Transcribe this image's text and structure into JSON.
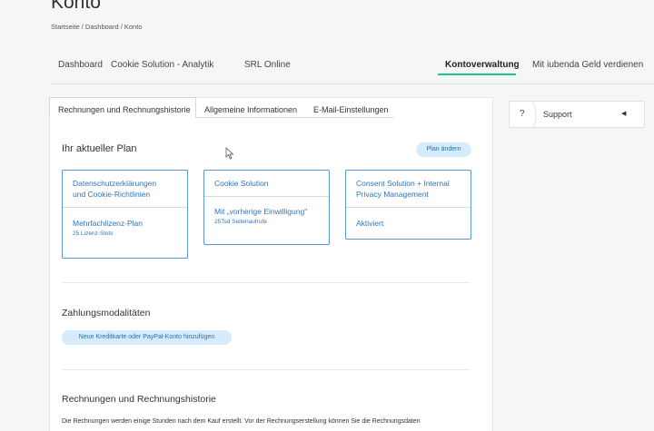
{
  "header": {
    "title": "Konto",
    "breadcrumb": "Startseite / Dashboard / Konto"
  },
  "topnav": {
    "dashboard": "Dashboard",
    "cookie_analytics": "Cookie Solution - Analytik",
    "srl_online": "SRL Online",
    "account_management": "Kontoverwaltung",
    "earn_money": "Mit iubenda Geld verdienen"
  },
  "tabs": {
    "invoices": "Rechnungen und Rechnungshistorie",
    "general_info": "Allgemeine Informationen",
    "email_settings": "E-Mail-Einstellungen"
  },
  "plan": {
    "title": "Ihr aktueller Plan",
    "change_button": "Plan ändern",
    "boxes": [
      {
        "title_line1": "Datenschutzerklärungen",
        "title_line2": "und Cookie-Richtlinien",
        "sub": "Mehrfachlizenz-Plan",
        "small": "25 Lizenz-Slots"
      },
      {
        "title_line1": "Cookie Solution",
        "sub": "Mit „vorherige Einwilligung\"",
        "small": "25Tsd Seitenaufrufe"
      },
      {
        "title_line1": "Consent Solution + Internal",
        "title_line2": "Privacy Management",
        "sub": "Aktiviert"
      }
    ]
  },
  "payment": {
    "title": "Zahlungsmodalitäten",
    "add_button": "Neue Kreditkarte oder PayPal-Konto hinzufügen"
  },
  "invoices": {
    "title": "Rechnungen und Rechnungshistorie",
    "text": "Die Rechnungen werden einige Stunden nach dem Kauf erstellt. Vor der Rechnungserstellung können Sie die Rechnungsdaten"
  },
  "support": {
    "icon_char": "?",
    "label": "Support",
    "caret": "◀"
  },
  "colors": {
    "accent_green": "#1cc691",
    "plan_blue": "#2f74c0",
    "pill_bg": "#d6ebfb"
  }
}
